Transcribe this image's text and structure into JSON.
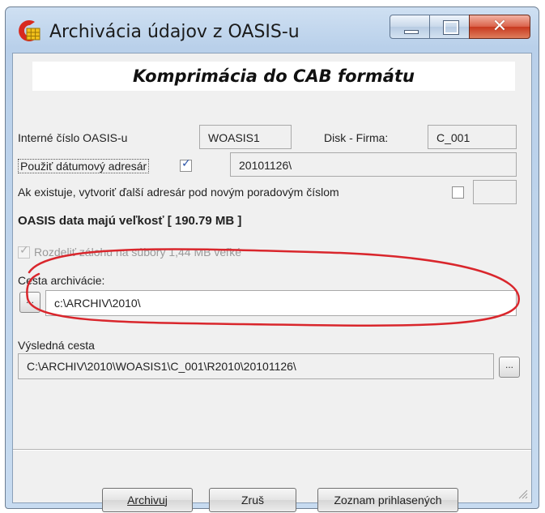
{
  "window": {
    "title": "Archivácia údajov z OASIS-u",
    "header": "Komprimácia do CAB formátu",
    "buttons": {
      "minimize": "minimize",
      "maximize": "maximize",
      "close": "✕"
    }
  },
  "form": {
    "internal_label": "Interné číslo OASIS-u",
    "internal_value": "WOASIS1",
    "disk_label": "Disk - Firma:",
    "disk_value": "C_001",
    "date_dir_label": "Použiť dátumový adresár",
    "date_dir_checked": true,
    "date_dir_value": "20101126\\",
    "new_dir_label": "Ak existuje, vytvoriť ďalší adresár pod novým poradovým číslom",
    "new_dir_checked": false,
    "new_dir_value": "",
    "data_size_text": "OASIS data majú veľkosť [ 190.79 MB ]",
    "split_label": "Rozdeliť zálohu na súbory 1,44 MB veľké",
    "split_checked": true,
    "split_enabled": false,
    "archive_path_label": "Cesta archivácie:",
    "archive_path_value": "c:\\ARCHIV\\2010\\",
    "browse_label": "...",
    "result_path_label": "Výsledná cesta",
    "result_path_value": "C:\\ARCHIV\\2010\\WOASIS1\\C_001\\R2010\\20101126\\",
    "result_browse_label": "..."
  },
  "footer": {
    "archive_button": "Archivuj",
    "cancel_button": "Zruš",
    "list_button": "Zoznam prihlasených"
  },
  "colors": {
    "annotation_ellipse": "#d9262c",
    "check_mark": "#2c55a8"
  }
}
